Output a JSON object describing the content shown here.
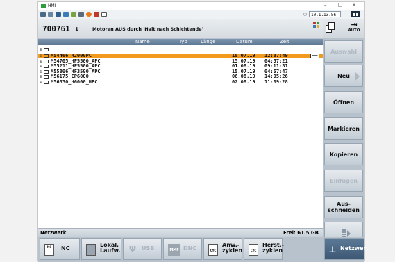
{
  "window": {
    "title": "HMI",
    "controls": [
      "–",
      "□",
      "×"
    ],
    "ip": "10.1.13.56"
  },
  "header": {
    "program": "700761",
    "program_arrow": "↓",
    "message": "Motoren AUS durch 'Halt nach Schichtende'"
  },
  "right_header": {
    "auto_label": "AUTO"
  },
  "columns": {
    "name": "Name",
    "typ": "Typ",
    "laenge": "Länge",
    "datum": "Datum",
    "zeit": "Zeit"
  },
  "root": ".",
  "files": [
    {
      "name": "M54466_H2000PC",
      "date": "18.07.19",
      "time": "12:37:49",
      "selected": true
    },
    {
      "name": "M54705_HF5500_APC",
      "date": "15.07.19",
      "time": "04:57:21"
    },
    {
      "name": "M55211_HF5500_APC",
      "date": "01.08.19",
      "time": "09:11:31"
    },
    {
      "name": "M55806_HF3500_APC",
      "date": "15.07.19",
      "time": "04:57:47"
    },
    {
      "name": "M56175_CP6000",
      "date": "06.08.19",
      "time": "14:05:26"
    },
    {
      "name": "M56330_H6000_HPC",
      "date": "02.08.19",
      "time": "11:09:28"
    }
  ],
  "status": {
    "left": "Netzwerk",
    "right": "Frei: 61.5 GB"
  },
  "vertical_softkeys": [
    {
      "label": "Auswahl",
      "enabled": false
    },
    {
      "label": "Neu",
      "enabled": true
    },
    {
      "label": "Öffnen",
      "enabled": true
    },
    {
      "label": "Markieren",
      "enabled": true
    },
    {
      "label": "Kopieren",
      "enabled": true
    },
    {
      "label": "Einfügen",
      "enabled": false
    },
    {
      "label": "Aus-\nschneiden",
      "enabled": true
    },
    {
      "label": "",
      "enabled": true
    }
  ],
  "horizontal_softkeys": [
    {
      "label": "NC",
      "icon": "NC",
      "enabled": true
    },
    {
      "label": "Lokal.\nLaufw.",
      "icon": "drive",
      "enabled": true
    },
    {
      "label": "USB",
      "icon": "usb",
      "enabled": false
    },
    {
      "label": "DNC",
      "icon": "MMF",
      "enabled": false
    },
    {
      "label": "Anw.-\nzyklen",
      "icon": "CYC",
      "enabled": true
    },
    {
      "label": "Herst.-\nzyklen",
      "icon": "CYC",
      "enabled": true
    },
    {
      "label": "Netzwer",
      "icon": "net",
      "enabled": true,
      "active": true
    }
  ]
}
